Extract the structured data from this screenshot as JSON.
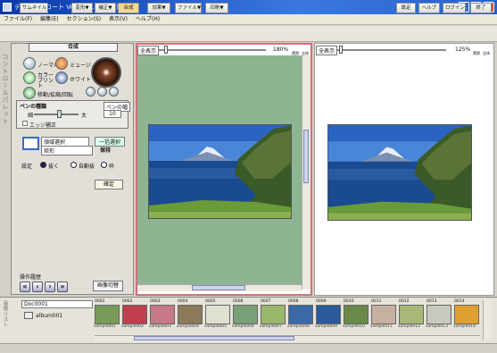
{
  "window": {
    "title": "デイジー・コート Ver.10 (10.0.0.4)",
    "min": "_",
    "max": "□",
    "close": "×"
  },
  "menu": [
    "ファイル(F)",
    "編集(E)",
    "セクション(S)",
    "表示(V)",
    "ヘルプ(H)"
  ],
  "toolbar": {
    "left": [
      "サムネイル",
      "変形▼",
      "補正▼",
      "合成",
      "効果▼",
      "ファイル▼",
      "印刷▼"
    ],
    "right": [
      "設定",
      "ヘルプ",
      "ログイン",
      "終了"
    ]
  },
  "side_label": "コントロールパレット",
  "panel": {
    "title": "合成",
    "modes": [
      "ノーマル",
      "ミュージ",
      "カラープリント",
      "ホワイト",
      "移動/拡縮/回転"
    ],
    "pen_label": "ペンの種類",
    "pen_sub": "ペンの幅",
    "pen_min": "細",
    "pen_max": "太",
    "pen_value": "10",
    "edge_label": "エッジ補正",
    "area_label": "領域選択",
    "area_dropdown": "矩形",
    "area_tag": "一括選択",
    "keep_label": "保持",
    "mode_label": "設定",
    "radio": [
      "抜く",
      "自動抜",
      "枠"
    ],
    "confirm": "確定",
    "ops_label": "操作履歴",
    "nav": [
      "«",
      "‹",
      "›",
      "»"
    ],
    "edit_btn": "画像切替"
  },
  "left_view": {
    "label": "全表示",
    "zoom": "180%",
    "btn1": "実際",
    "btn2": "全体"
  },
  "right_view": {
    "label": "全表示",
    "zoom": "125%",
    "btn1": "実際",
    "btn2": "全体"
  },
  "filmstrip": {
    "side_label": "画像リスト",
    "folder": "Doc0001",
    "folder_sub": "album001",
    "thumbs": [
      {
        "num": "0001",
        "label": "sample001",
        "color": "#7a9a5a"
      },
      {
        "num": "0002",
        "label": "sample002",
        "color": "#c04050"
      },
      {
        "num": "0003",
        "label": "sample003",
        "color": "#c87a8a"
      },
      {
        "num": "0004",
        "label": "sample004",
        "color": "#8a7a5a"
      },
      {
        "num": "0005",
        "label": "sample005",
        "color": "#e0e0d0"
      },
      {
        "num": "0006",
        "label": "sample006",
        "color": "#7aa07a"
      },
      {
        "num": "0007",
        "label": "sample007",
        "color": "#9ab86a"
      },
      {
        "num": "0008",
        "label": "sample008",
        "color": "#3a6aa8"
      },
      {
        "num": "0009",
        "label": "sample009",
        "color": "#2a5a9a"
      },
      {
        "num": "0010",
        "label": "sample010",
        "color": "#6a8a4a"
      },
      {
        "num": "0011",
        "label": "sample011",
        "color": "#c8b0a0"
      },
      {
        "num": "0012",
        "label": "sample012",
        "color": "#a8b878"
      },
      {
        "num": "0013",
        "label": "sample013",
        "color": "#c8c8c0"
      },
      {
        "num": "0014",
        "label": "sample014",
        "color": "#e0a030"
      }
    ]
  },
  "colors": {
    "canvas_border": "#d0707c",
    "canvas_bg": "#8db592",
    "title_bar": "#0a3aa8"
  }
}
